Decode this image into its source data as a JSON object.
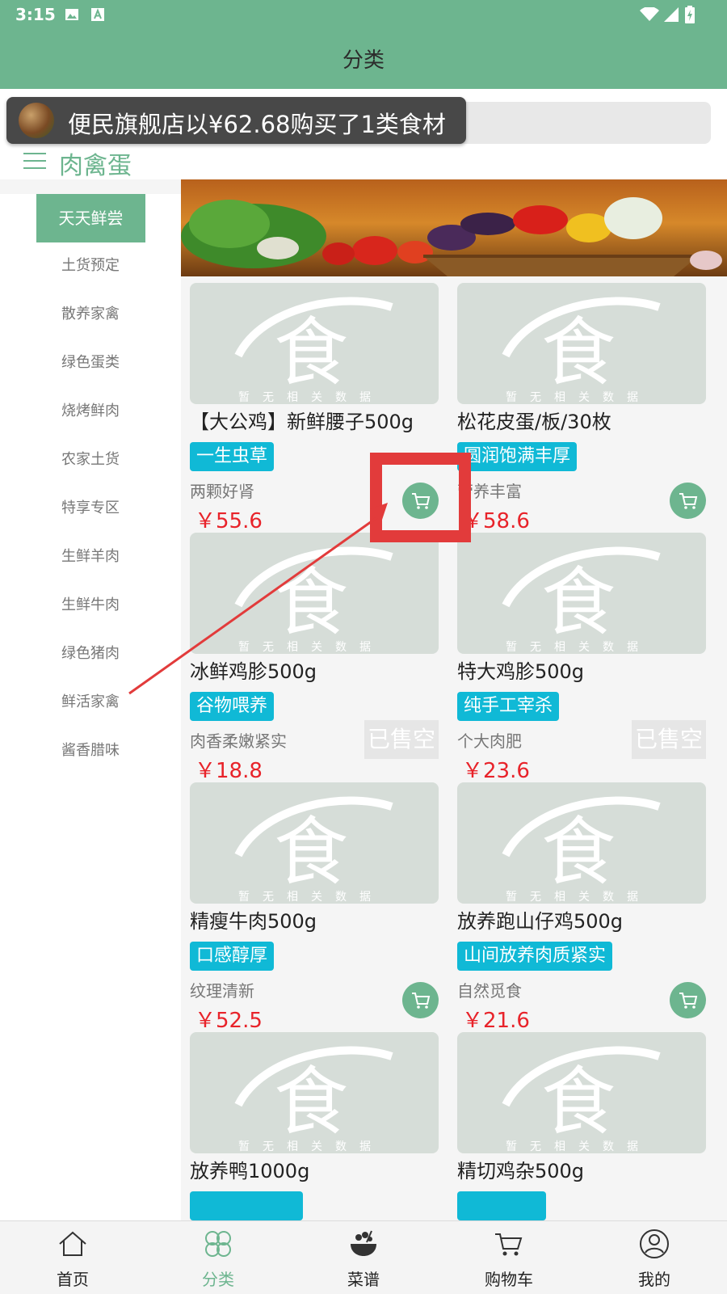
{
  "status_bar": {
    "time": "3:15"
  },
  "header": {
    "title": "分类"
  },
  "toast": {
    "message": "便民旗舰店以¥62.68购买了1类食材"
  },
  "category_title": "肉禽蛋",
  "sidebar": {
    "items": [
      {
        "label": "天天鲜尝",
        "active": true
      },
      {
        "label": "土货预定"
      },
      {
        "label": "散养家禽"
      },
      {
        "label": "绿色蛋类"
      },
      {
        "label": "烧烤鲜肉"
      },
      {
        "label": "农家土货"
      },
      {
        "label": "特享专区"
      },
      {
        "label": "生鲜羊肉"
      },
      {
        "label": "生鲜牛肉"
      },
      {
        "label": "绿色猪肉"
      },
      {
        "label": "鲜活家禽"
      },
      {
        "label": "酱香腊味"
      }
    ]
  },
  "placeholder_image": {
    "big_char": "食",
    "caption": "暂无相关数据"
  },
  "products": [
    {
      "name": "【大公鸡】新鲜腰子500g",
      "tag": "一生虫草",
      "subtitle": "两颗好肾",
      "price": "￥55.6",
      "sold_out": false
    },
    {
      "name": "松花皮蛋/板/30枚",
      "tag": "圆润饱满丰厚",
      "subtitle": "营养丰富",
      "price": "￥58.6",
      "sold_out": false
    },
    {
      "name": "冰鲜鸡胗500g",
      "tag": "谷物喂养",
      "subtitle": "肉香柔嫩紧实",
      "price": "￥18.8",
      "sold_out": true,
      "sold_out_label": "已售空"
    },
    {
      "name": "特大鸡胗500g",
      "tag": "纯手工宰杀",
      "subtitle": "个大肉肥",
      "price": "￥23.6",
      "sold_out": true,
      "sold_out_label": "已售空"
    },
    {
      "name": "精瘦牛肉500g",
      "tag": "口感醇厚",
      "subtitle": "纹理清新",
      "price": "￥52.5",
      "sold_out": false
    },
    {
      "name": "放养跑山仔鸡500g",
      "tag": "山间放养肉质紧实",
      "subtitle": "自然觅食",
      "price": "￥21.6",
      "sold_out": false
    },
    {
      "name": "放养鸭1000g",
      "tag": "",
      "subtitle": "",
      "price": "",
      "sold_out": false
    },
    {
      "name": "精切鸡杂500g",
      "tag": "",
      "subtitle": "",
      "price": "",
      "sold_out": false
    }
  ],
  "bottom_nav": [
    {
      "label": "首页",
      "icon": "home-icon"
    },
    {
      "label": "分类",
      "icon": "category-icon",
      "active": true
    },
    {
      "label": "菜谱",
      "icon": "recipe-icon"
    },
    {
      "label": "购物车",
      "icon": "cart-icon"
    },
    {
      "label": "我的",
      "icon": "profile-icon"
    }
  ],
  "colors": {
    "brand_green": "#6db58f",
    "tag_cyan": "#10b9d6",
    "price_red": "#e8232a",
    "annotation_red": "#e23b3b"
  }
}
